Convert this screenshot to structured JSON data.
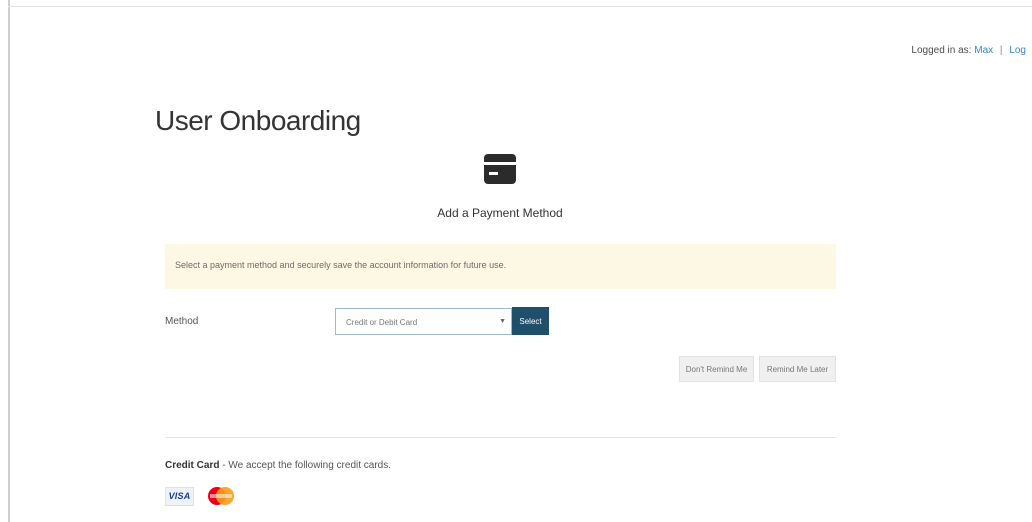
{
  "header": {
    "logged_in_prefix": "Logged in as:",
    "username": "Max",
    "separator": "|",
    "logout_label": "Log"
  },
  "page": {
    "title": "User Onboarding"
  },
  "step": {
    "icon": "credit-card-icon",
    "label": "Add a Payment Method"
  },
  "info": {
    "message": "Select a payment method and securely save the account information for future use."
  },
  "method": {
    "label": "Method",
    "selected": "Credit or Debit Card",
    "select_button": "Select"
  },
  "actions": {
    "dont_remind": "Don't Remind Me",
    "remind_later": "Remind Me Later"
  },
  "credit_card": {
    "title": "Credit Card",
    "description": "- We accept the following credit cards.",
    "cards": [
      {
        "name": "VISA",
        "icon": "visa-logo"
      },
      {
        "name": "MasterCard",
        "icon": "mastercard-logo"
      }
    ]
  },
  "colors": {
    "info_bg": "#fcf8e3",
    "primary_button": "#1f4f6b",
    "link": "#3a86b8",
    "mastercard_red": "#eb001b",
    "mastercard_orange": "#f79e1b"
  }
}
